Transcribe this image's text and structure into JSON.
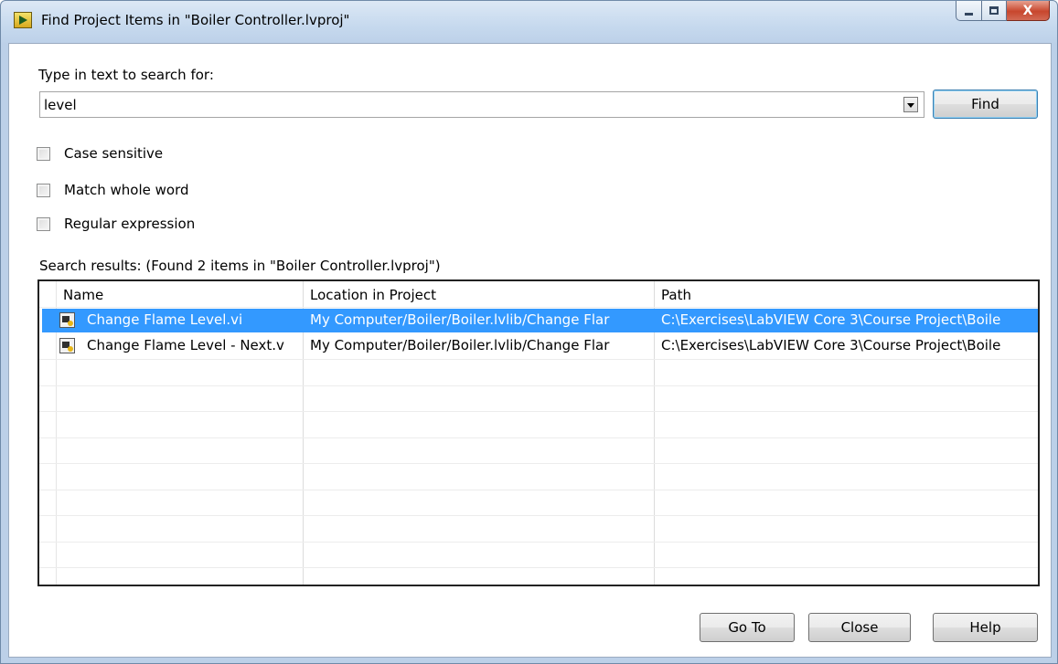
{
  "window": {
    "title": "Find Project Items in \"Boiler Controller.lvproj\"",
    "close_glyph": "X"
  },
  "search": {
    "prompt_label": "Type in text to search for:",
    "value": "level",
    "find_label": "Find"
  },
  "options": [
    {
      "label": "Case sensitive",
      "checked": false
    },
    {
      "label": "Match whole word",
      "checked": false
    },
    {
      "label": "Regular expression",
      "checked": false
    }
  ],
  "results": {
    "summary": "Search results: (Found 2 items in \"Boiler Controller.lvproj\")",
    "columns": [
      "Name",
      "Location in Project",
      "Path"
    ],
    "rows": [
      {
        "name": "Change Flame Level.vi",
        "location": "My Computer/Boiler/Boiler.lvlib/Change Flar",
        "path": "C:\\Exercises\\LabVIEW Core 3\\Course Project\\Boile",
        "selected": true,
        "icon": "vi-file-icon"
      },
      {
        "name": "Change Flame Level - Next.v",
        "location": "My Computer/Boiler/Boiler.lvlib/Change Flar",
        "path": "C:\\Exercises\\LabVIEW Core 3\\Course Project\\Boile",
        "selected": false,
        "icon": "vi-file-icon"
      }
    ]
  },
  "footer": {
    "goto_label": "Go To",
    "close_label": "Close",
    "help_label": "Help"
  },
  "colors": {
    "selection": "#3399ff",
    "default_button_border": "#3c7fb1"
  }
}
